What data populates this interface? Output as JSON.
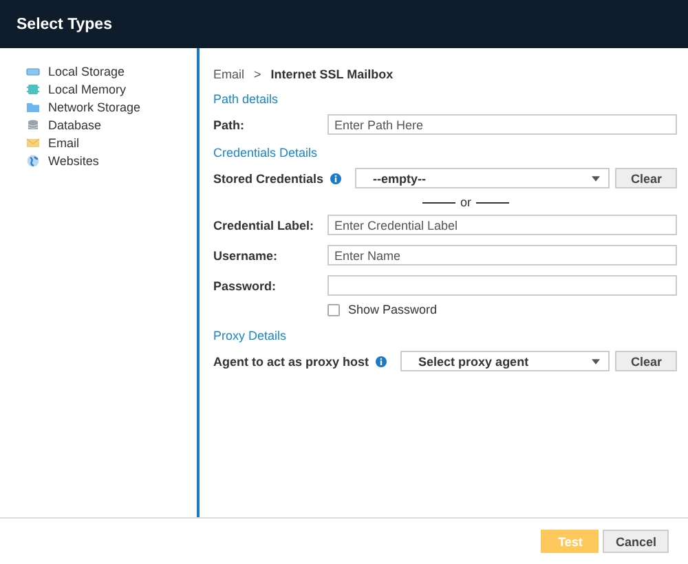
{
  "window": {
    "title": "Select Types"
  },
  "sidebar": {
    "items": [
      {
        "label": "Local Storage",
        "kind": "drive"
      },
      {
        "label": "Local Memory",
        "kind": "chip"
      },
      {
        "label": "Network Storage",
        "kind": "folder"
      },
      {
        "label": "Database",
        "kind": "database"
      },
      {
        "label": "Email",
        "kind": "mail"
      },
      {
        "label": "Websites",
        "kind": "globe"
      }
    ]
  },
  "breadcrumb": {
    "parent": "Email",
    "separator": ">",
    "current": "Internet SSL Mailbox"
  },
  "sections": [
    {
      "title": "Path details",
      "rows": [
        {
          "kind": "text",
          "label": "Path:",
          "placeholder": "Enter Path Here"
        }
      ]
    },
    {
      "title": "Credentials Details",
      "rows": [
        {
          "kind": "select",
          "label": "Stored Credentials",
          "info": true,
          "value": "--empty--",
          "button": "Clear"
        },
        {
          "kind": "separator",
          "text": "or"
        },
        {
          "kind": "text",
          "label": "Credential Label:",
          "placeholder": "Enter Credential Label"
        },
        {
          "kind": "text",
          "label": "Username:",
          "placeholder": "Enter Name"
        },
        {
          "kind": "password",
          "label": "Password:"
        },
        {
          "kind": "checkbox",
          "label": "Show Password",
          "checked": false
        }
      ]
    },
    {
      "title": "Proxy Details",
      "rows": [
        {
          "kind": "select",
          "label": "Agent to act as proxy host",
          "info": true,
          "value": "Select proxy agent",
          "button": "Clear"
        }
      ]
    }
  ],
  "footer": {
    "buttons": [
      {
        "label": "Test",
        "kind": "primary",
        "disabled": true
      },
      {
        "label": "Cancel",
        "kind": "secondary",
        "disabled": false
      }
    ]
  }
}
